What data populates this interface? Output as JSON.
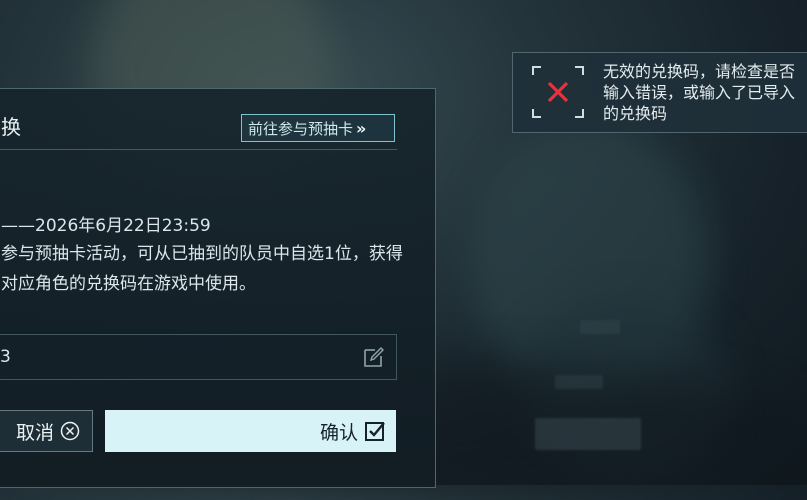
{
  "dialog": {
    "title": "换",
    "goto_label": "前往参与预抽卡",
    "goto_chevron": "»",
    "date_range": "——2026年6月22日23:59",
    "description": "参与预抽卡活动，可从已抽到的队员中自选1位，获得对应角色的兑换码在游戏中使用。",
    "code_value": "3",
    "cancel_label": "取消",
    "confirm_label": "确认",
    "icons": {
      "edit": "edit-icon",
      "cancel": "close-circle-icon",
      "confirm": "checkbox-checked-icon"
    }
  },
  "toast": {
    "message": "无效的兑换码，请检查是否输入错误，或输入了已导入的兑换码",
    "icon": "error-x-icon",
    "accent_color": "#e8323c"
  }
}
